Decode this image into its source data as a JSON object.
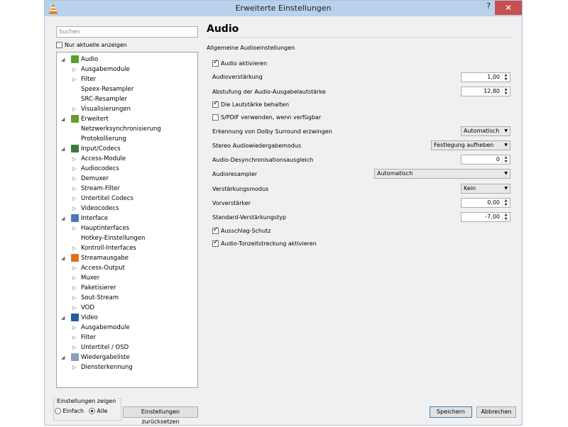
{
  "window": {
    "title": "Erweiterte Einstellungen",
    "help": "?",
    "close": "✕"
  },
  "left": {
    "search_placeholder": "Suchen",
    "only_current": "Nur aktuelle anzeigen",
    "tree": [
      {
        "label": "Audio",
        "level": 0,
        "icon": "audio-note",
        "color": "#5aa02c",
        "expanded": true
      },
      {
        "label": "Ausgabemodule",
        "level": 1,
        "arrow": true
      },
      {
        "label": "Filter",
        "level": 1,
        "arrow": true
      },
      {
        "label": "Speex-Resampler",
        "level": 1
      },
      {
        "label": "SRC-Resampler",
        "level": 1
      },
      {
        "label": "Visualisierungen",
        "level": 1,
        "arrow": true
      },
      {
        "label": "Erweitert",
        "level": 0,
        "icon": "chip",
        "color": "#6a9c2a",
        "expanded": true
      },
      {
        "label": "Netzwerksynchronisierung",
        "level": 1
      },
      {
        "label": "Protokollierung",
        "level": 1
      },
      {
        "label": "Input/Codecs",
        "level": 0,
        "icon": "codec",
        "color": "#3a7a3a",
        "expanded": true
      },
      {
        "label": "Access-Module",
        "level": 1,
        "arrow": true
      },
      {
        "label": "Audiocodecs",
        "level": 1,
        "arrow": true
      },
      {
        "label": "Demuxer",
        "level": 1,
        "arrow": true
      },
      {
        "label": "Stream-Filter",
        "level": 1,
        "arrow": true
      },
      {
        "label": "Untertitel Codecs",
        "level": 1,
        "arrow": true
      },
      {
        "label": "Videocodecs",
        "level": 1,
        "arrow": true
      },
      {
        "label": "Interface",
        "level": 0,
        "icon": "interface",
        "color": "#4a78b8",
        "expanded": true
      },
      {
        "label": "Hauptinterfaces",
        "level": 1,
        "arrow": true
      },
      {
        "label": "Hotkey-Einstellungen",
        "level": 1
      },
      {
        "label": "Kontroll-Interfaces",
        "level": 1,
        "arrow": true
      },
      {
        "label": "Streamausgabe",
        "level": 0,
        "icon": "stream",
        "color": "#e07020",
        "expanded": true
      },
      {
        "label": "Access-Output",
        "level": 1,
        "arrow": true
      },
      {
        "label": "Muxer",
        "level": 1,
        "arrow": true
      },
      {
        "label": "Paketisierer",
        "level": 1,
        "arrow": true
      },
      {
        "label": "Sout-Stream",
        "level": 1,
        "arrow": true
      },
      {
        "label": "VOD",
        "level": 1,
        "arrow": true
      },
      {
        "label": "Video",
        "level": 0,
        "icon": "film",
        "color": "#2a5aa0",
        "expanded": true
      },
      {
        "label": "Ausgabemodule",
        "level": 1,
        "arrow": true
      },
      {
        "label": "Filter",
        "level": 1,
        "arrow": true
      },
      {
        "label": "Untertitel / OSD",
        "level": 1,
        "arrow": true
      },
      {
        "label": "Wiedergabeliste",
        "level": 0,
        "icon": "playlist",
        "color": "#8aa0c0",
        "expanded": true
      },
      {
        "label": "Diensterkennung",
        "level": 1,
        "arrow": true
      }
    ],
    "show_settings_label": "Einstellungen zeigen",
    "radio_simple": "Einfach",
    "radio_all": "Alle",
    "reset_button": "Einstellungen zurücksetzen"
  },
  "right": {
    "title": "Audio",
    "section": "Allgemeine Audioeinstellungen",
    "audio_enable": "Audio aktivieren",
    "gain_label": "Audioverstärkung",
    "gain_value": "1,00",
    "volume_step_label": "Abstufung der Audio-Ausgabelautstärke",
    "volume_step_value": "12,80",
    "keep_volume": "Die Lautstärke behalten",
    "spdif": "S/PDIF verwenden, wenn verfügbar",
    "dolby_label": "Erkennung von Dolby Surround erzwingen",
    "dolby_value": "Automatisch",
    "stereo_label": "Stereo Audiowiedergabemodus",
    "stereo_value": "Festlegung aufheben",
    "desync_label": "Audio-Desynchronisationsausgleich",
    "desync_value": "0",
    "resampler_label": "Audioresampler",
    "resampler_value": "Automatisch",
    "replaygain_label": "Verstärkungsmodus",
    "replaygain_value": "Kein",
    "preamp_label": "Vorverstärker",
    "preamp_value": "0,00",
    "default_gain_label": "Standard-Verstärkungstyp",
    "default_gain_value": "-7,00",
    "peak_protection": "Ausschlag-Schutz",
    "time_stretch": "Audio-Tonzeitstreckung aktivieren"
  },
  "buttons": {
    "save": "Speichern",
    "cancel": "Abbrechen"
  }
}
